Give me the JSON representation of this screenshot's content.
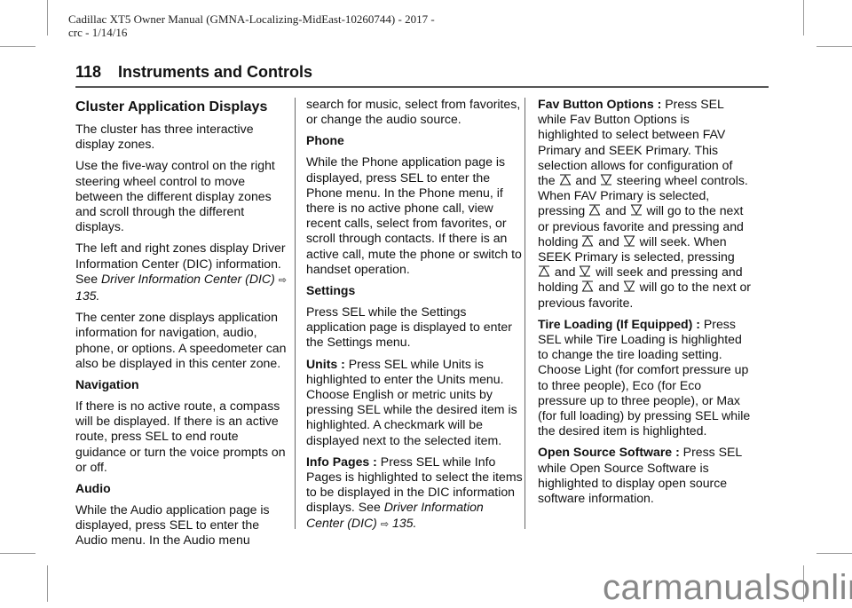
{
  "document_meta": {
    "line1": "Cadillac XT5 Owner Manual (GMNA-Localizing-MidEast-10260744) - 2017 -",
    "line2": "crc - 1/14/16"
  },
  "running_header": {
    "page_number": "118",
    "section": "Instruments and Controls"
  },
  "column1": {
    "title": "Cluster Application Displays",
    "p1": "The cluster has three interactive display zones.",
    "p2": "Use the five-way control on the right steering wheel control to move between the different display zones and scroll through the different displays.",
    "p3_text": "The left and right zones display Driver Information Center (DIC) information. See ",
    "p3_link": "Driver Information Center (DIC)",
    "p3_ref": "135",
    "p3_end": ".",
    "p4": "The center zone displays application information for navigation, audio, phone, or options. A speedometer can also be displayed in this center zone.",
    "nav_heading": "Navigation",
    "nav_text": "If there is no active route, a compass will be displayed. If there is an active route, press SEL to end route guidance or turn the voice prompts on or off.",
    "audio_heading": "Audio",
    "audio_text": "While the Audio application page is displayed, press SEL to enter the Audio menu. In the Audio menu"
  },
  "column2": {
    "audio_cont": "search for music, select from favorites, or change the audio source.",
    "phone_heading": "Phone",
    "phone_text": "While the Phone application page is displayed, press SEL to enter the Phone menu. In the Phone menu, if there is no active phone call, view recent calls, select from favorites, or scroll through contacts. If there is an active call, mute the phone or switch to handset operation.",
    "settings_heading": "Settings",
    "settings_text": "Press SEL while the Settings application page is displayed to enter the Settings menu.",
    "units_label": "Units :",
    "units_text": " Press SEL while Units is highlighted to enter the Units menu. Choose English or metric units by pressing SEL while the desired item is highlighted. A checkmark will be displayed next to the selected item.",
    "info_label": "Info Pages :",
    "info_text": " Press SEL while Info Pages is highlighted to select the items to be displayed in the DIC information displays. See ",
    "info_link": "Driver Information Center (DIC)",
    "info_ref": "135",
    "info_end": "."
  },
  "column3": {
    "fav_label": "Fav Button Options :",
    "fav_t1": " Press SEL while Fav Button Options is highlighted to select between FAV Primary and SEEK Primary. This selection allows for configuration of the ",
    "and": " and ",
    "fav_t2": " steering wheel controls. When FAV Primary is selected, pressing ",
    "fav_t3": " will go to the next or previous favorite and pressing and holding ",
    "fav_t4": " will seek. When SEEK Primary is selected, pressing ",
    "fav_t5": " will seek and pressing and holding ",
    "fav_t6": "and ",
    "fav_t7": " will go to the next or previous favorite.",
    "tire_label": "Tire Loading (If Equipped) :",
    "tire_text": " Press SEL while Tire Loading is highlighted to change the tire loading setting. Choose Light (for comfort pressure up to three people), Eco (for Eco pressure up to three people), or Max (for full loading) by pressing SEL while the desired item is highlighted.",
    "oss_label": "Open Source Software :",
    "oss_text": " Press SEL while Open Source Software is highlighted to display open source software information."
  },
  "icons": {
    "page_ref": "⇨",
    "up": "seek-up-icon",
    "down": "seek-down-icon"
  },
  "watermark": "carmanualsonline.info"
}
